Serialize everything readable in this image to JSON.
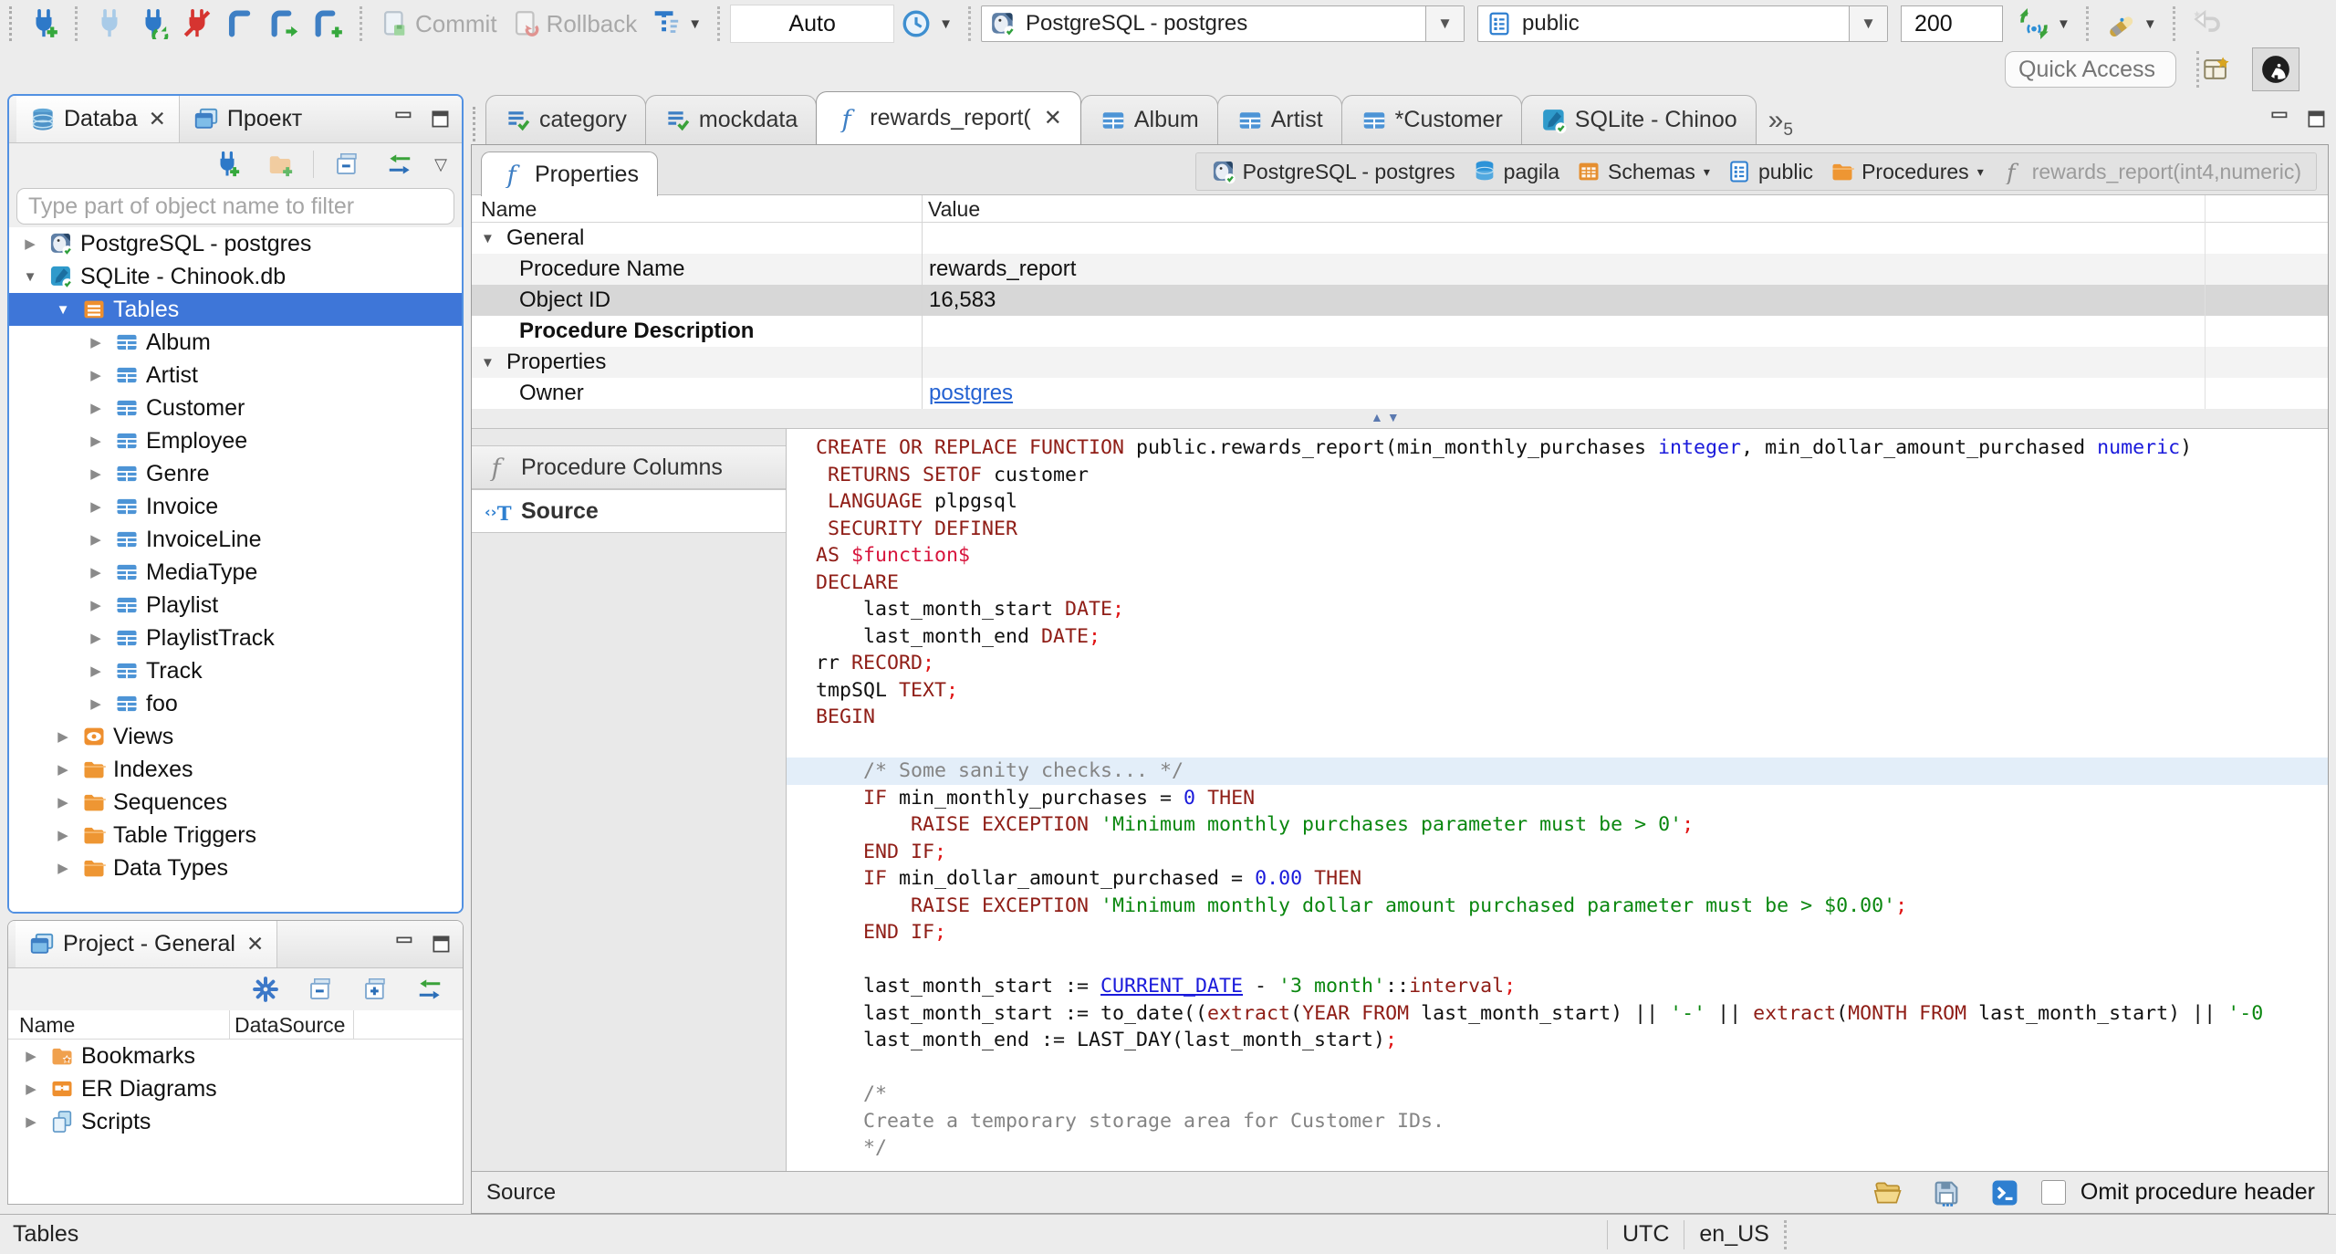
{
  "toolbar": {
    "auto_label": "Auto",
    "commit_label": "Commit",
    "rollback_label": "Rollback",
    "connection_combo": "PostgreSQL - postgres",
    "schema_combo": "public",
    "fetch_size": "200",
    "quick_access_placeholder": "Quick Access"
  },
  "editor_tabs": [
    {
      "label": "category",
      "icon": "sql-script",
      "active": false,
      "closable": false
    },
    {
      "label": "mockdata",
      "icon": "sql-script",
      "active": false,
      "closable": false
    },
    {
      "label": "rewards_report(",
      "icon": "function",
      "active": true,
      "closable": true
    },
    {
      "label": "Album",
      "icon": "table",
      "active": false,
      "closable": false
    },
    {
      "label": "Artist",
      "icon": "table",
      "active": false,
      "closable": false
    },
    {
      "label": "*Customer",
      "icon": "table",
      "active": false,
      "closable": false
    },
    {
      "label": "SQLite - Chinoo",
      "icon": "sqlite",
      "active": false,
      "closable": false
    }
  ],
  "more_tabs_count": "5",
  "properties_view": {
    "tab_label": "Properties",
    "breadcrumb": [
      {
        "label": "PostgreSQL - postgres",
        "icon": "postgres",
        "dropdown": false,
        "muted": false
      },
      {
        "label": "pagila",
        "icon": "database-cyl",
        "dropdown": false,
        "muted": false
      },
      {
        "label": "Schemas",
        "icon": "schemas",
        "dropdown": true,
        "muted": false
      },
      {
        "label": "public",
        "icon": "schema-card",
        "dropdown": false,
        "muted": false
      },
      {
        "label": "Procedures",
        "icon": "folder",
        "dropdown": true,
        "muted": false
      },
      {
        "label": "rewards_report(int4,numeric)",
        "icon": "function-gray",
        "dropdown": false,
        "muted": true
      }
    ],
    "grid": {
      "columns": [
        "Name",
        "Value"
      ],
      "rows": [
        {
          "name": "General",
          "value": "",
          "group": true,
          "indent": 0,
          "selected": false,
          "bold": false,
          "link": false,
          "stripe": false
        },
        {
          "name": "Procedure Name",
          "value": "rewards_report",
          "group": false,
          "indent": 1,
          "selected": false,
          "bold": false,
          "link": false,
          "stripe": true
        },
        {
          "name": "Object ID",
          "value": "16,583",
          "group": false,
          "indent": 1,
          "selected": true,
          "bold": false,
          "link": false,
          "stripe": false
        },
        {
          "name": "Procedure Description",
          "value": "",
          "group": false,
          "indent": 1,
          "selected": false,
          "bold": true,
          "link": false,
          "stripe": false
        },
        {
          "name": "Properties",
          "value": "",
          "group": true,
          "indent": 0,
          "selected": false,
          "bold": false,
          "link": false,
          "stripe": true
        },
        {
          "name": "Owner",
          "value": "postgres",
          "group": false,
          "indent": 1,
          "selected": false,
          "bold": false,
          "link": true,
          "stripe": false
        }
      ]
    }
  },
  "subtabs": [
    {
      "label": "Procedure Columns",
      "icon": "function-gray",
      "active": false
    },
    {
      "label": "Source",
      "icon": "source",
      "active": true
    }
  ],
  "source": {
    "status_label": "Source",
    "omit_checkbox_label": "Omit procedure header",
    "highlight_line": 13,
    "lines": [
      [
        [
          "k",
          "CREATE OR REPLACE FUNCTION"
        ],
        [
          "p",
          " public.rewards_report(min_monthly_purchases "
        ],
        [
          "t",
          "integer"
        ],
        [
          "p",
          ", min_dollar_amount_purchased "
        ],
        [
          "t",
          "numeric"
        ],
        [
          "p",
          ")"
        ]
      ],
      [
        [
          "p",
          " "
        ],
        [
          "k",
          "RETURNS SETOF"
        ],
        [
          "p",
          " customer"
        ]
      ],
      [
        [
          "p",
          " "
        ],
        [
          "k",
          "LANGUAGE"
        ],
        [
          "p",
          " plpgsql"
        ]
      ],
      [
        [
          "p",
          " "
        ],
        [
          "k",
          "SECURITY DEFINER"
        ]
      ],
      [
        [
          "k",
          "AS"
        ],
        [
          "p",
          " "
        ],
        [
          "d",
          "$function$"
        ]
      ],
      [
        [
          "k",
          "DECLARE"
        ]
      ],
      [
        [
          "p",
          "    last_month_start "
        ],
        [
          "k",
          "DATE"
        ],
        [
          "s",
          ";"
        ]
      ],
      [
        [
          "p",
          "    last_month_end "
        ],
        [
          "k",
          "DATE"
        ],
        [
          "s",
          ";"
        ]
      ],
      [
        [
          "p",
          "rr "
        ],
        [
          "k",
          "RECORD"
        ],
        [
          "s",
          ";"
        ]
      ],
      [
        [
          "p",
          "tmpSQL "
        ],
        [
          "k",
          "TEXT"
        ],
        [
          "s",
          ";"
        ]
      ],
      [
        [
          "k",
          "BEGIN"
        ]
      ],
      [],
      [
        [
          "c",
          "    /* Some sanity checks... */"
        ]
      ],
      [
        [
          "p",
          "    "
        ],
        [
          "k",
          "IF"
        ],
        [
          "p",
          " min_monthly_purchases = "
        ],
        [
          "n",
          "0"
        ],
        [
          "p",
          " "
        ],
        [
          "k",
          "THEN"
        ]
      ],
      [
        [
          "p",
          "        "
        ],
        [
          "k",
          "RAISE EXCEPTION"
        ],
        [
          "p",
          " "
        ],
        [
          "str",
          "'Minimum monthly purchases parameter must be > 0'"
        ],
        [
          "s",
          ";"
        ]
      ],
      [
        [
          "p",
          "    "
        ],
        [
          "k",
          "END IF"
        ],
        [
          "s",
          ";"
        ]
      ],
      [
        [
          "p",
          "    "
        ],
        [
          "k",
          "IF"
        ],
        [
          "p",
          " min_dollar_amount_purchased = "
        ],
        [
          "n",
          "0.00"
        ],
        [
          "p",
          " "
        ],
        [
          "k",
          "THEN"
        ]
      ],
      [
        [
          "p",
          "        "
        ],
        [
          "k",
          "RAISE EXCEPTION"
        ],
        [
          "p",
          " "
        ],
        [
          "str",
          "'Minimum monthly dollar amount purchased parameter must be > $0.00'"
        ],
        [
          "s",
          ";"
        ]
      ],
      [
        [
          "p",
          "    "
        ],
        [
          "k",
          "END IF"
        ],
        [
          "s",
          ";"
        ]
      ],
      [],
      [
        [
          "p",
          "    last_month_start := "
        ],
        [
          "cd",
          "CURRENT_DATE"
        ],
        [
          "p",
          " - "
        ],
        [
          "str",
          "'3 month'"
        ],
        [
          "p",
          "::"
        ],
        [
          "k",
          "interval"
        ],
        [
          "s",
          ";"
        ]
      ],
      [
        [
          "p",
          "    last_month_start := to_date(("
        ],
        [
          "k",
          "extract"
        ],
        [
          "p",
          "("
        ],
        [
          "k",
          "YEAR FROM"
        ],
        [
          "p",
          " last_month_start) || "
        ],
        [
          "str",
          "'-'"
        ],
        [
          "p",
          " || "
        ],
        [
          "k",
          "extract"
        ],
        [
          "p",
          "("
        ],
        [
          "k",
          "MONTH FROM"
        ],
        [
          "p",
          " last_month_start) || "
        ],
        [
          "str",
          "'-0"
        ]
      ],
      [
        [
          "p",
          "    last_month_end := LAST_DAY(last_month_start)"
        ],
        [
          "s",
          ";"
        ]
      ],
      [],
      [
        [
          "c",
          "    /*"
        ]
      ],
      [
        [
          "c",
          "    Create a temporary storage area for Customer IDs."
        ]
      ],
      [
        [
          "c",
          "    */"
        ]
      ]
    ]
  },
  "sidebar": {
    "tabs": [
      {
        "label": "Databa",
        "icon": "database-nav",
        "active": true,
        "closable": true
      },
      {
        "label": "Проект",
        "icon": "projects",
        "active": false,
        "closable": false
      }
    ],
    "filter_placeholder": "Type part of object name to filter",
    "tree": [
      {
        "label": "PostgreSQL - postgres",
        "icon": "postgres",
        "arrow": "right",
        "indent": 0,
        "selected": false
      },
      {
        "label": "SQLite - Chinook.db",
        "icon": "sqlite",
        "arrow": "down",
        "indent": 0,
        "selected": false
      },
      {
        "label": "Tables",
        "icon": "tables",
        "arrow": "down",
        "indent": 1,
        "selected": true
      },
      {
        "label": "Album",
        "icon": "table",
        "arrow": "right",
        "indent": 2,
        "selected": false
      },
      {
        "label": "Artist",
        "icon": "table",
        "arrow": "right",
        "indent": 2,
        "selected": false
      },
      {
        "label": "Customer",
        "icon": "table",
        "arrow": "right",
        "indent": 2,
        "selected": false
      },
      {
        "label": "Employee",
        "icon": "table",
        "arrow": "right",
        "indent": 2,
        "selected": false
      },
      {
        "label": "Genre",
        "icon": "table",
        "arrow": "right",
        "indent": 2,
        "selected": false
      },
      {
        "label": "Invoice",
        "icon": "table",
        "arrow": "right",
        "indent": 2,
        "selected": false
      },
      {
        "label": "InvoiceLine",
        "icon": "table",
        "arrow": "right",
        "indent": 2,
        "selected": false
      },
      {
        "label": "MediaType",
        "icon": "table",
        "arrow": "right",
        "indent": 2,
        "selected": false
      },
      {
        "label": "Playlist",
        "icon": "table",
        "arrow": "right",
        "indent": 2,
        "selected": false
      },
      {
        "label": "PlaylistTrack",
        "icon": "table",
        "arrow": "right",
        "indent": 2,
        "selected": false
      },
      {
        "label": "Track",
        "icon": "table",
        "arrow": "right",
        "indent": 2,
        "selected": false
      },
      {
        "label": "foo",
        "icon": "table",
        "arrow": "right",
        "indent": 2,
        "selected": false
      },
      {
        "label": "Views",
        "icon": "views",
        "arrow": "right",
        "indent": 1,
        "selected": false
      },
      {
        "label": "Indexes",
        "icon": "folder",
        "arrow": "right",
        "indent": 1,
        "selected": false
      },
      {
        "label": "Sequences",
        "icon": "folder",
        "arrow": "right",
        "indent": 1,
        "selected": false
      },
      {
        "label": "Table Triggers",
        "icon": "folder",
        "arrow": "right",
        "indent": 1,
        "selected": false
      },
      {
        "label": "Data Types",
        "icon": "folder",
        "arrow": "right",
        "indent": 1,
        "selected": false
      }
    ]
  },
  "project_panel": {
    "tab_label": "Project - General",
    "columns": [
      "Name",
      "DataSource"
    ],
    "items": [
      {
        "label": "Bookmarks",
        "icon": "bookmarks"
      },
      {
        "label": "ER Diagrams",
        "icon": "er-diagrams"
      },
      {
        "label": "Scripts",
        "icon": "scripts"
      }
    ]
  },
  "statusbar": {
    "left": "Tables",
    "timezone": "UTC",
    "locale": "en_US"
  }
}
